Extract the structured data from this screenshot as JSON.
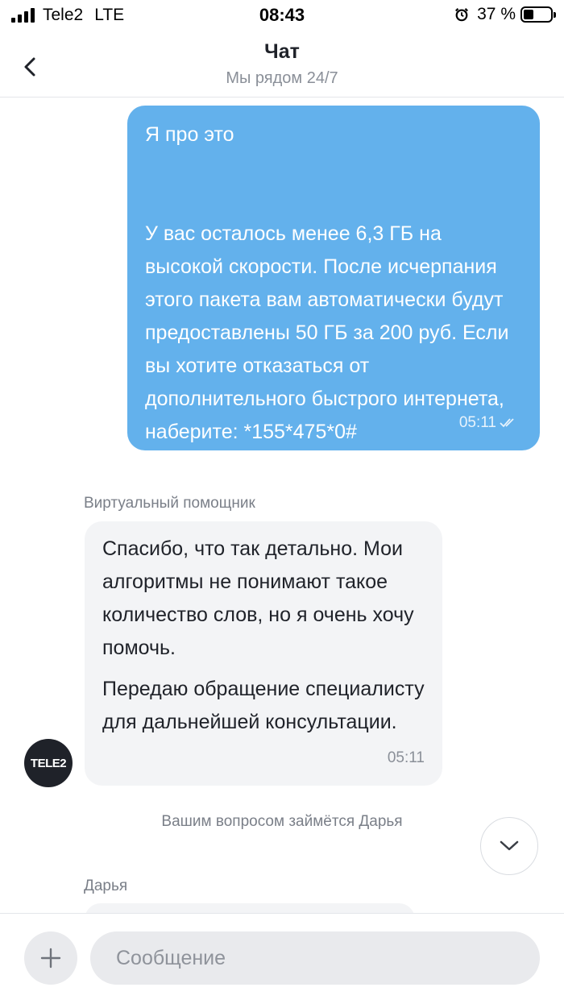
{
  "status_bar": {
    "carrier": "Tele2",
    "network": "LTE",
    "time": "08:43",
    "battery": "37 %"
  },
  "header": {
    "title": "Чат",
    "subtitle": "Мы рядом 24/7"
  },
  "messages": {
    "outgoing": {
      "line1": "Я про это",
      "body": "У вас осталось менее 6,3 ГБ на высокой скорости. После исчерпания этого пакета вам автоматически будут предоставлены 50 ГБ за 200 руб. Если вы хотите отказаться от дополнительного быстрого интернета, наберите: *155*475*0#",
      "time": "05:11",
      "status_icon": "double-check-icon"
    },
    "bot_sender": "Виртуальный помощник",
    "incoming": {
      "paragraph1": "Спасибо, что так детально. Мои алгоритмы не понимают такое количество слов, но я очень хочу помочь.",
      "paragraph2": "Передаю обращение специалисту для дальнейшей консультации.",
      "time": "05:11"
    },
    "avatar_label": "TELE2",
    "system_note": "Вашим вопросом займётся Дарья",
    "agent_sender": "Дарья"
  },
  "composer": {
    "placeholder": "Сообщение"
  },
  "colors": {
    "outgoing_bubble": "#63b1ec",
    "incoming_bubble": "#f3f4f6"
  }
}
